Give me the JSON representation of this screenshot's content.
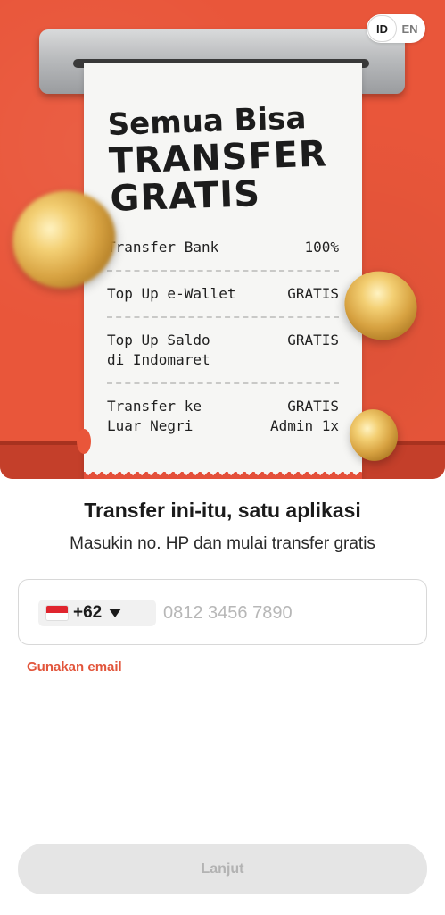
{
  "hero": {
    "headline": {
      "line1": "Semua Bisa",
      "line2": "TRANSFER",
      "line3": "GRATIS"
    },
    "receipt_rows": [
      {
        "label": "Transfer Bank",
        "value": "100%"
      },
      {
        "label": "Top Up e-Wallet",
        "value": "GRATIS"
      },
      {
        "label": "Top Up Saldo\ndi Indomaret",
        "value": "GRATIS"
      },
      {
        "label": "Transfer ke\nLuar Negri",
        "value": "GRATIS\nAdmin 1x"
      }
    ],
    "background_color": "#e9563a"
  },
  "language_toggle": {
    "options": [
      "ID",
      "EN"
    ],
    "selected": "ID"
  },
  "main": {
    "title": "Transfer ini-itu, satu aplikasi",
    "subtitle": "Masukin no. HP dan mulai transfer gratis",
    "phone": {
      "country_flag_icon": "indonesia-flag-icon",
      "dial_code": "+62",
      "placeholder": "0812 3456 7890",
      "value": ""
    },
    "email_link": "Gunakan email",
    "continue_button": "Lanjut"
  },
  "colors": {
    "accent": "#e2553b",
    "button_disabled_bg": "#e5e5e5",
    "button_disabled_text": "#b3b3b3"
  }
}
